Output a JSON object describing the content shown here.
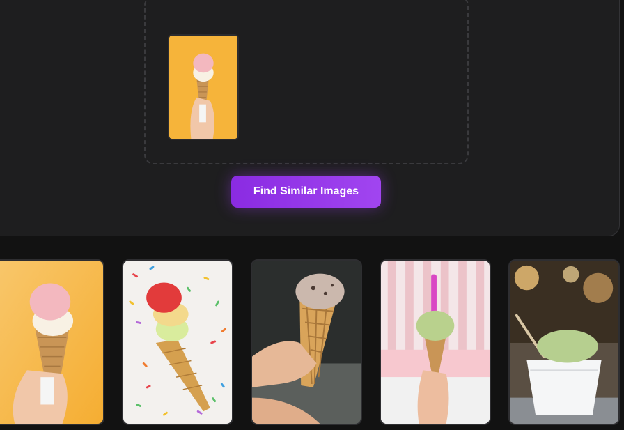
{
  "upload": {
    "preview_alt": "Uploaded query image: hand holding strawberry and vanilla ice cream cone on yellow background"
  },
  "actions": {
    "find_similar_label": "Find Similar Images",
    "accent_color": "#9b3cf0"
  },
  "results": [
    {
      "alt": "Hand holding strawberry and vanilla ice cream cone on yellow background"
    },
    {
      "alt": "Triple scoop cone with red, yellow and green scoops on sprinkles"
    },
    {
      "alt": "Hand holding chocolate chip ice cream in waffle cone"
    },
    {
      "alt": "Hand holding pistachio ice cream cone with pink stick"
    },
    {
      "alt": "Pistachio gelato in white paper cup with wooden spoon"
    }
  ]
}
